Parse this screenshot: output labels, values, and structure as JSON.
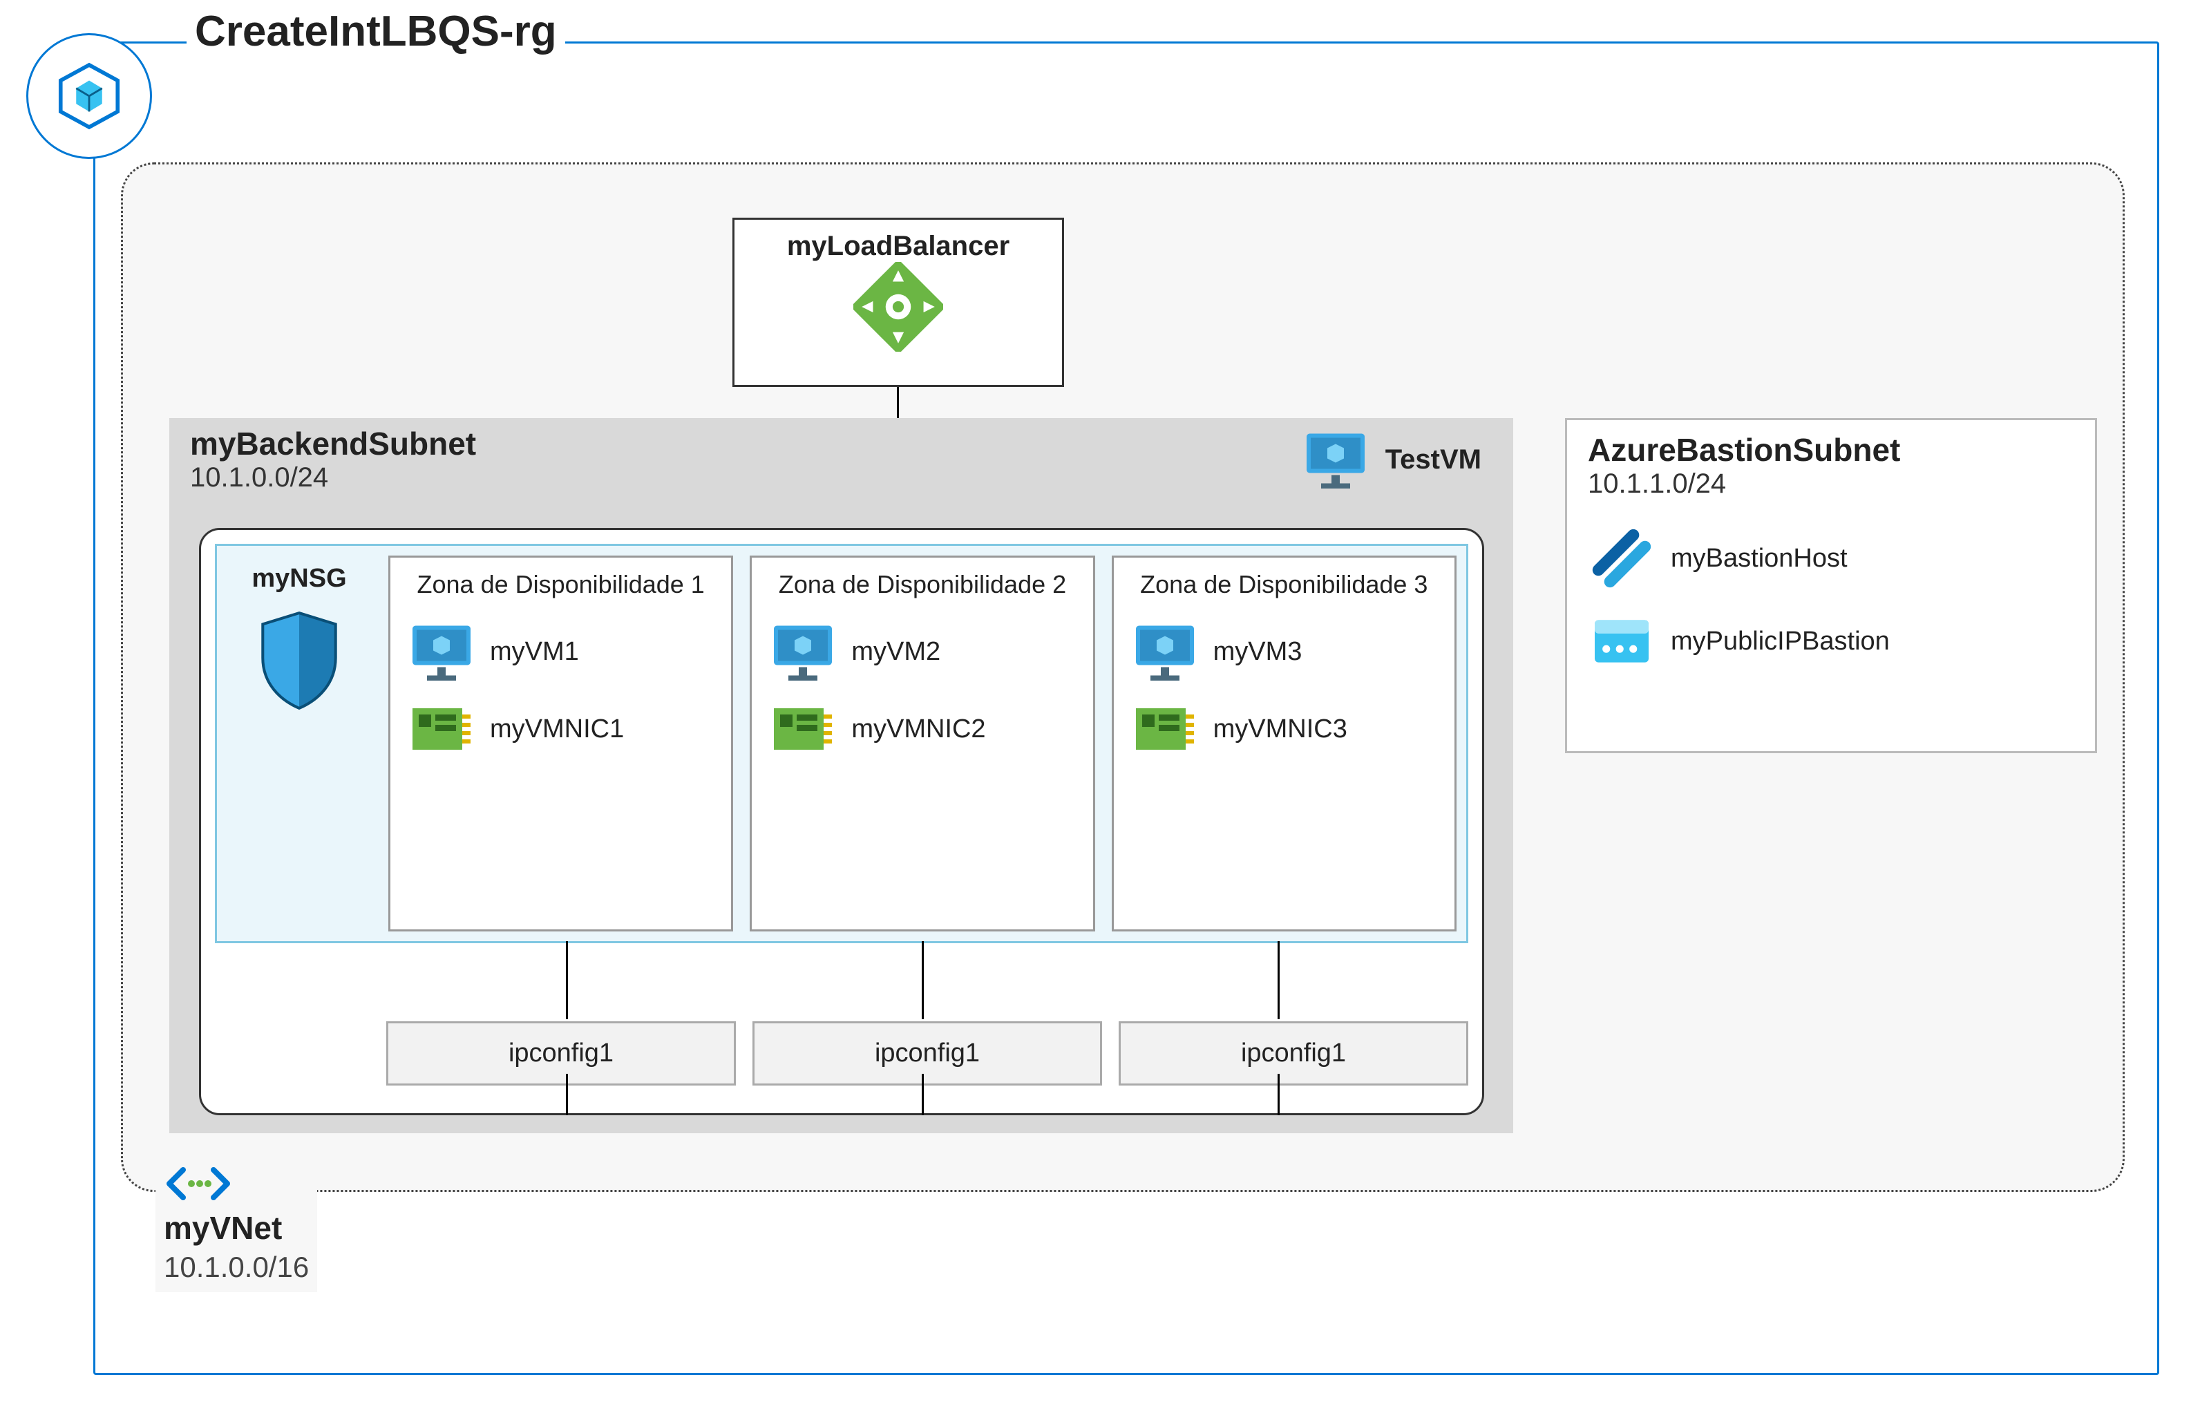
{
  "resource_group": {
    "name": "CreateIntLBQS-rg"
  },
  "vnet": {
    "icon": "vnet-icon",
    "name": "myVNet",
    "cidr": "10.1.0.0/16"
  },
  "load_balancer": {
    "name": "myLoadBalancer"
  },
  "backend_subnet": {
    "name": "myBackendSubnet",
    "cidr": "10.1.0.0/24",
    "test_vm_label": "TestVM",
    "nsg_label": "myNSG",
    "zones": [
      {
        "title": "Zona de Disponibilidade 1",
        "vm": "myVM1",
        "nic": "myVMNIC1",
        "ipconfig": "ipconfig1"
      },
      {
        "title": "Zona de Disponibilidade 2",
        "vm": "myVM2",
        "nic": "myVMNIC2",
        "ipconfig": "ipconfig1"
      },
      {
        "title": "Zona de Disponibilidade 3",
        "vm": "myVM3",
        "nic": "myVMNIC3",
        "ipconfig": "ipconfig1"
      }
    ]
  },
  "bastion_subnet": {
    "name": "AzureBastionSubnet",
    "cidr": "10.1.1.0/24",
    "host_label": "myBastionHost",
    "pip_label": "myPublicIPBastion"
  }
}
